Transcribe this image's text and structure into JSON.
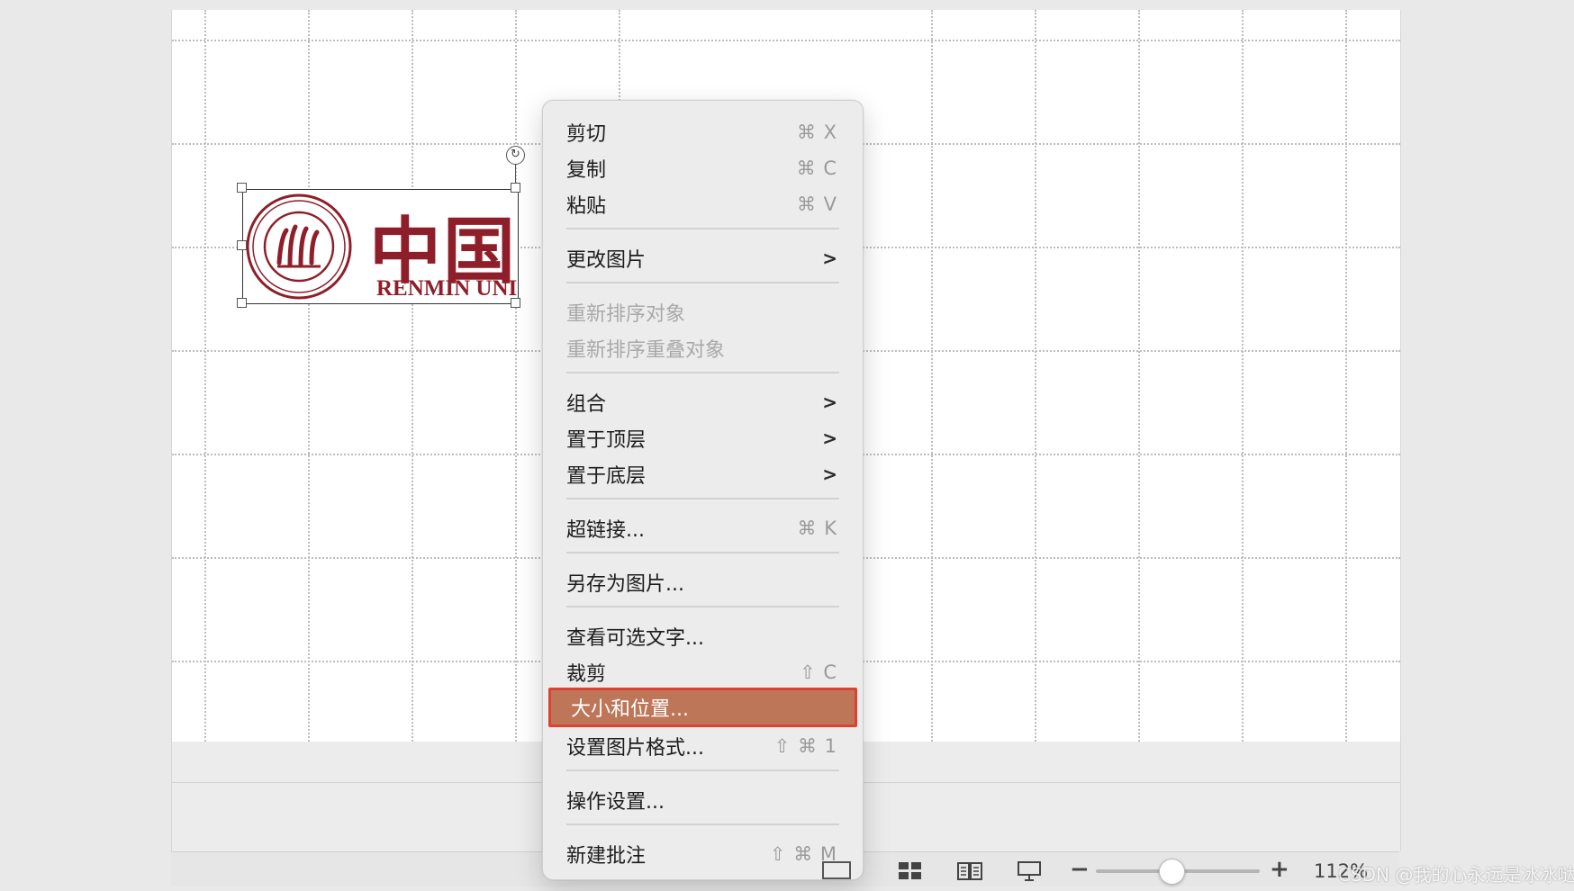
{
  "slide": {
    "picture": {
      "logo_cn": "中国人",
      "logo_en": "RENMIN UNI"
    }
  },
  "context_menu": {
    "items": [
      {
        "label": "剪切",
        "shortcut": "⌘ X"
      },
      {
        "label": "复制",
        "shortcut": "⌘ C"
      },
      {
        "label": "粘贴",
        "shortcut": "⌘ V"
      },
      {
        "label": "更改图片",
        "submenu": ">"
      },
      {
        "label": "重新排序对象",
        "disabled": true
      },
      {
        "label": "重新排序重叠对象",
        "disabled": true
      },
      {
        "label": "组合",
        "submenu": ">"
      },
      {
        "label": "置于顶层",
        "submenu": ">"
      },
      {
        "label": "置于底层",
        "submenu": ">"
      },
      {
        "label": "超链接...",
        "shortcut": "⌘ K"
      },
      {
        "label": "另存为图片..."
      },
      {
        "label": "查看可选文字..."
      },
      {
        "label": "裁剪",
        "shortcut": "⇧ C"
      },
      {
        "label": "大小和位置...",
        "highlighted": true
      },
      {
        "label": "设置图片格式...",
        "shortcut": "⇧ ⌘ 1"
      },
      {
        "label": "操作设置..."
      },
      {
        "label": "新建批注",
        "shortcut": "⇧ ⌘ M"
      }
    ],
    "highlight_color": "#bd7657",
    "highlight_border_color": "#e0402f"
  },
  "status_bar": {
    "zoom_minus": "−",
    "zoom_plus": "+",
    "zoom_level": "112%",
    "zoom_fraction": 0.46,
    "icons": [
      "normal-view-icon",
      "slide-sorter-icon",
      "reading-view-icon",
      "slideshow-icon"
    ]
  },
  "watermark": "CSDN @我的心永远是冰冰哒"
}
